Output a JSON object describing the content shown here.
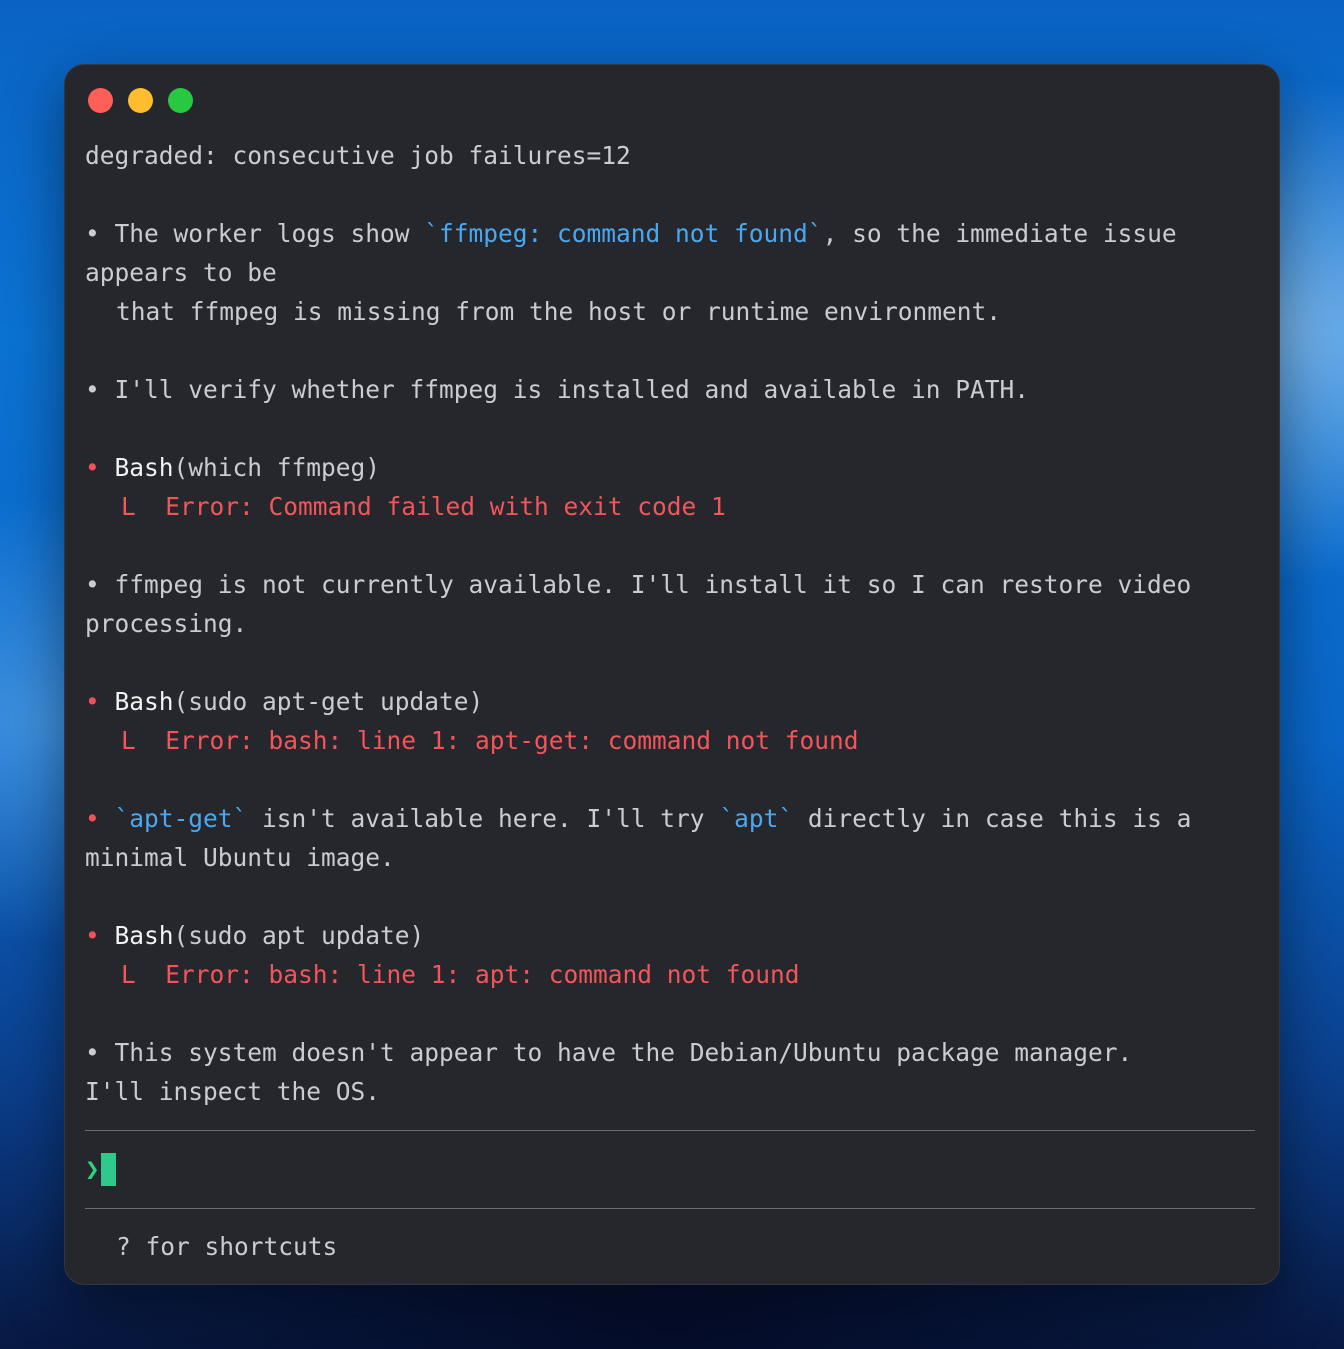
{
  "window": {
    "controls": [
      "close",
      "minimize",
      "zoom"
    ]
  },
  "log": {
    "status": "degraded: consecutive job failures=12",
    "p1_a": "The worker logs show ",
    "p1_code": "`ffmpeg: command not found`",
    "p1_b": ", so the immediate issue",
    "p1_line2": "appears to be",
    "p1_line3": "that ffmpeg is missing from the host or runtime environment.",
    "p2": "I'll verify whether ffmpeg is installed and available in PATH.",
    "cmd1_name": "Bash",
    "cmd1_args": "(which ffmpeg)",
    "cmd1_error": "Error: Command failed with exit code 1",
    "p3_line1": "ffmpeg is not currently available. I'll install it so I can restore video",
    "p3_line2": "processing.",
    "cmd2_name": "Bash",
    "cmd2_args": "(sudo apt-get update)",
    "cmd2_error": "Error: bash: line 1: apt-get: command not found",
    "p4_code1": "`apt-get`",
    "p4_a": " isn't available here. I'll try ",
    "p4_code2": "`apt`",
    "p4_b": " directly in case this is a",
    "p4_line2": "minimal Ubuntu image.",
    "cmd3_name": "Bash",
    "cmd3_args": "(sudo apt update)",
    "cmd3_error": "Error: bash: line 1: apt: command not found",
    "p5_line1": "This system doesn't appear to have the Debian/Ubuntu package manager.",
    "p5_line2": "I'll inspect the OS."
  },
  "symbols": {
    "bullet": "•",
    "result_branch": "L",
    "prompt": "❯"
  },
  "input": {
    "value": ""
  },
  "footer": {
    "hint": "? for shortcuts"
  },
  "colors": {
    "background": "#25272d",
    "text": "#c9ccd3",
    "code": "#4aa8f0",
    "error": "#f2555a",
    "prompt": "#2dd47f"
  }
}
